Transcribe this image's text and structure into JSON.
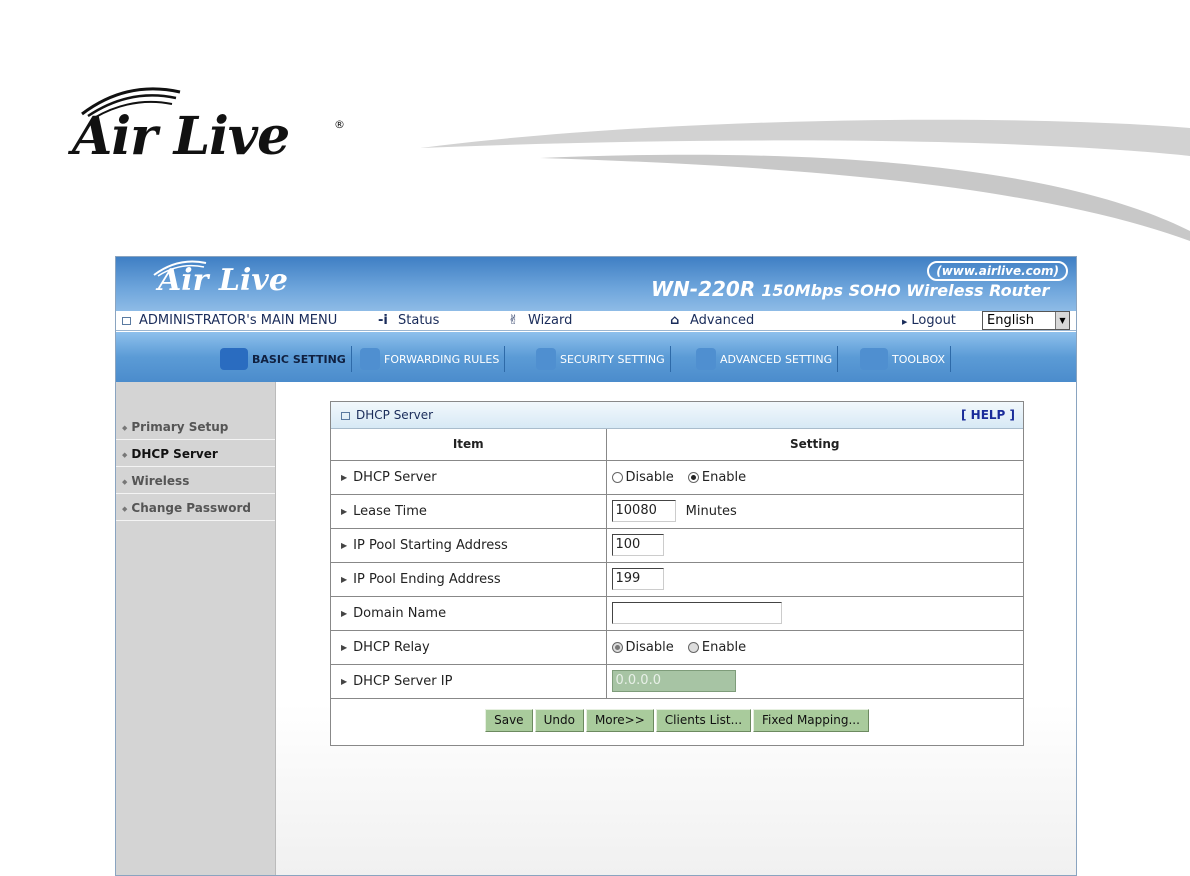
{
  "doc_header": {
    "logo_text": "Air Live",
    "logo_registered": "®"
  },
  "router": {
    "brand": "Air Live",
    "url": "(www.airlive.com)",
    "model": "WN-220R",
    "model_desc": "150Mbps SOHO Wireless Router",
    "menubar": {
      "main_menu": "ADMINISTRATOR's MAIN MENU",
      "status": "Status",
      "wizard": "Wizard",
      "advanced": "Advanced",
      "logout": "Logout",
      "language": "English"
    },
    "tabs": [
      {
        "label": "BASIC SETTING",
        "icon": "folder-icon",
        "color": "#2a6cc0"
      },
      {
        "label": "FORWARDING RULES",
        "icon": "forwarding-icon",
        "color": "#4f8fd0"
      },
      {
        "label": "SECURITY SETTING",
        "icon": "security-icon",
        "color": "#4f8fd0"
      },
      {
        "label": "ADVANCED SETTING",
        "icon": "advanced-icon",
        "color": "#4f8fd0"
      },
      {
        "label": "TOOLBOX",
        "icon": "toolbox-icon",
        "color": "#4f8fd0"
      }
    ],
    "sidebar": [
      {
        "label": "Primary Setup"
      },
      {
        "label": "DHCP Server"
      },
      {
        "label": "Wireless"
      },
      {
        "label": "Change Password"
      }
    ],
    "panel": {
      "title": "DHCP Server",
      "help": "[ HELP ]",
      "col_item": "Item",
      "col_setting": "Setting",
      "rows": {
        "dhcp_server": {
          "label": "DHCP Server",
          "opt_disable": "Disable",
          "opt_enable": "Enable",
          "selected": "Enable"
        },
        "lease_time": {
          "label": "Lease Time",
          "value": "10080",
          "unit": "Minutes"
        },
        "pool_start": {
          "label": "IP Pool Starting Address",
          "value": "100"
        },
        "pool_end": {
          "label": "IP Pool Ending Address",
          "value": "199"
        },
        "domain_name": {
          "label": "Domain Name",
          "value": ""
        },
        "dhcp_relay": {
          "label": "DHCP Relay",
          "opt_disable": "Disable",
          "opt_enable": "Enable",
          "selected": "Disable"
        },
        "server_ip": {
          "label": "DHCP Server IP",
          "value": "0.0.0.0"
        }
      },
      "buttons": {
        "save": "Save",
        "undo": "Undo",
        "more": "More>>",
        "clients": "Clients List...",
        "fixed": "Fixed Mapping..."
      }
    }
  },
  "colors": {
    "header_blue": "#3f7fc4",
    "tabbar_blue": "#5b9bd6",
    "button_green": "#a9cb9c",
    "sidebar_grey": "#d4d4d4",
    "disabled_field": "#a7c4a4"
  }
}
